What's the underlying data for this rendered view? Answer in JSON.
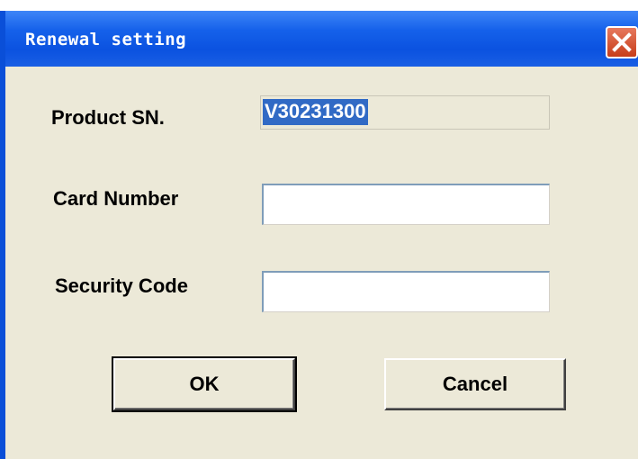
{
  "window": {
    "title": "Renewal setting",
    "close_icon": "close-x-icon"
  },
  "form": {
    "product_sn_label": "Product SN.",
    "product_sn_value": "V30231300",
    "card_number_label": "Card Number",
    "card_number_value": "",
    "security_code_label": "Security Code",
    "security_code_value": ""
  },
  "buttons": {
    "ok_label": "OK",
    "cancel_label": "Cancel"
  },
  "colors": {
    "titlebar": "#0b52e0",
    "dialog_bg": "#ece9d8",
    "selection": "#316ac5",
    "close_button": "#d9593a"
  }
}
